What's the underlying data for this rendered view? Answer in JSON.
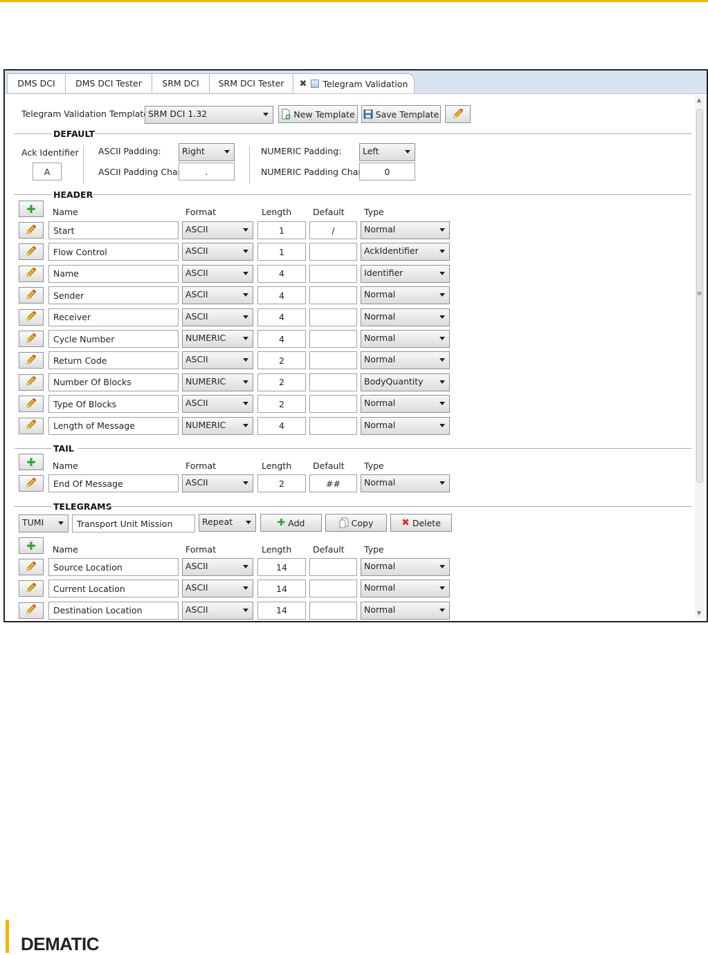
{
  "tabs": [
    {
      "label": "DMS DCI"
    },
    {
      "label": "DMS DCI  Tester"
    },
    {
      "label": "SRM DCI"
    },
    {
      "label": "SRM DCI Tester"
    },
    {
      "label": "Telegram Validation"
    }
  ],
  "template": {
    "label": "Telegram Validation Template:",
    "selected": "SRM DCI 1.32",
    "new_label": "New Template",
    "save_label": "Save Template"
  },
  "default": {
    "section": "DEFAULT",
    "ack_label": "Ack Identifier",
    "ack_value": "A",
    "ascii_padding_label": "ASCII Padding:",
    "ascii_padding_value": "Right",
    "ascii_char_label": "ASCII Padding Char:",
    "ascii_char_value": ".",
    "numeric_padding_label": "NUMERIC Padding:",
    "numeric_padding_value": "Left",
    "numeric_char_label": "NUMERIC Padding Char:",
    "numeric_char_value": "0"
  },
  "columns": {
    "name": "Name",
    "format": "Format",
    "length": "Length",
    "default": "Default",
    "type": "Type"
  },
  "header": {
    "section": "HEADER",
    "rows": [
      {
        "name": "Start",
        "format": "ASCII",
        "length": "1",
        "default": "/",
        "type": "Normal"
      },
      {
        "name": "Flow Control",
        "format": "ASCII",
        "length": "1",
        "default": "",
        "type": "AckIdentifier"
      },
      {
        "name": "Name",
        "format": "ASCII",
        "length": "4",
        "default": "",
        "type": "Identifier"
      },
      {
        "name": "Sender",
        "format": "ASCII",
        "length": "4",
        "default": "",
        "type": "Normal"
      },
      {
        "name": "Receiver",
        "format": "ASCII",
        "length": "4",
        "default": "",
        "type": "Normal"
      },
      {
        "name": "Cycle Number",
        "format": "NUMERIC",
        "length": "4",
        "default": "",
        "type": "Normal"
      },
      {
        "name": "Return Code",
        "format": "ASCII",
        "length": "2",
        "default": "",
        "type": "Normal"
      },
      {
        "name": "Number Of Blocks",
        "format": "NUMERIC",
        "length": "2",
        "default": "",
        "type": "BodyQuantity"
      },
      {
        "name": "Type Of Blocks",
        "format": "ASCII",
        "length": "2",
        "default": "",
        "type": "Normal"
      },
      {
        "name": "Length of Message",
        "format": "NUMERIC",
        "length": "4",
        "default": "",
        "type": "Normal"
      }
    ]
  },
  "tail": {
    "section": "TAIL",
    "rows": [
      {
        "name": "End Of Message",
        "format": "ASCII",
        "length": "2",
        "default": "##",
        "type": "Normal"
      }
    ]
  },
  "telegrams": {
    "section": "TELEGRAMS",
    "code": "TUMI",
    "description": "Transport Unit Mission",
    "mode": "Repeat",
    "add_label": "Add",
    "copy_label": "Copy",
    "delete_label": "Delete",
    "rows": [
      {
        "name": "Source Location",
        "format": "ASCII",
        "length": "14",
        "default": "",
        "type": "Normal"
      },
      {
        "name": "Current Location",
        "format": "ASCII",
        "length": "14",
        "default": "",
        "type": "Normal"
      },
      {
        "name": "Destination Location",
        "format": "ASCII",
        "length": "14",
        "default": "",
        "type": "Normal"
      }
    ]
  },
  "brand": "DEMATIC",
  "colors": {
    "accent": "#f6b700",
    "tabbar": "#d9e4f2",
    "add": "#2da82d",
    "delete": "#d83030"
  }
}
